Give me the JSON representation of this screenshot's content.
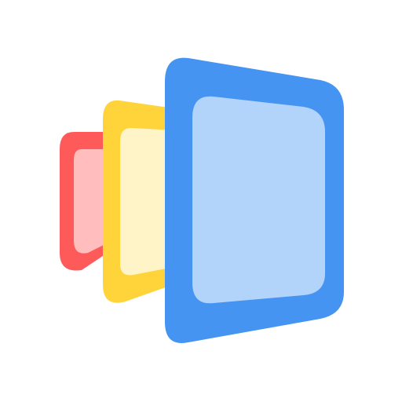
{
  "icon": {
    "name": "stacked-panels-app-icon",
    "background": "#ffffff",
    "panels": [
      {
        "name": "red-panel",
        "outer_color": "#ff5a5a",
        "inner_color": "#ffbdbd"
      },
      {
        "name": "yellow-panel",
        "outer_color": "#ffd43b",
        "inner_color": "#fff4c8"
      },
      {
        "name": "blue-panel",
        "outer_color": "#4594f2",
        "inner_color": "#b3d4fa"
      }
    ]
  }
}
